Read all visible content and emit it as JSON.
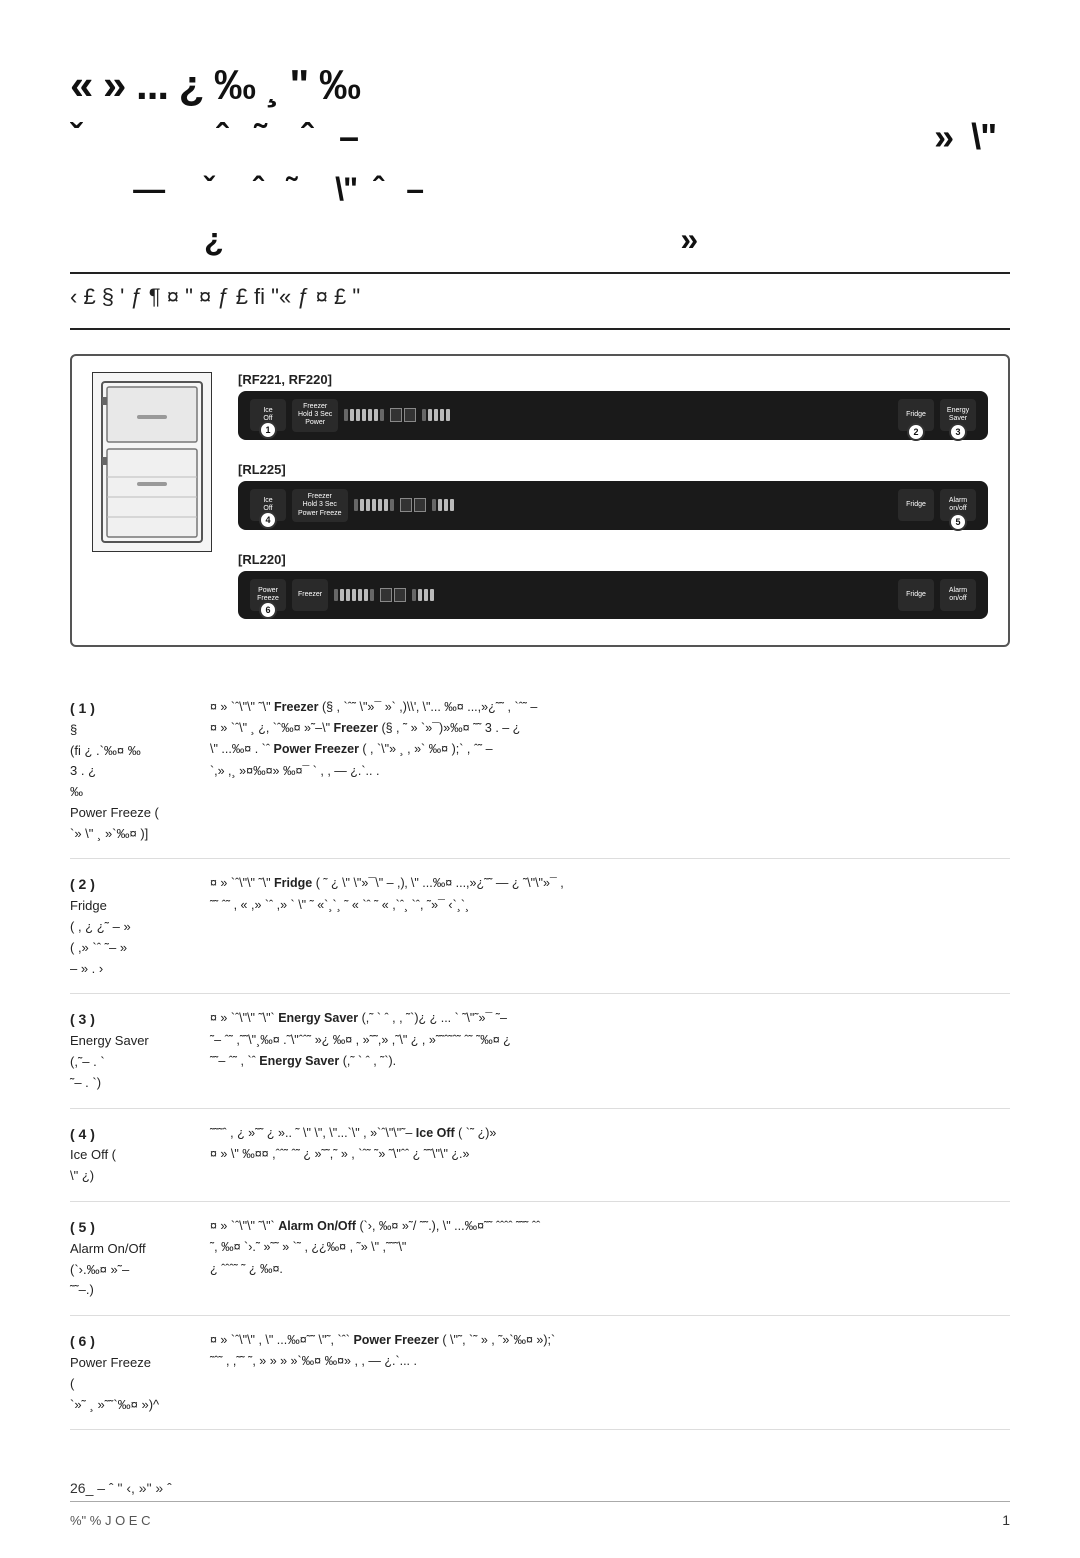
{
  "header": {
    "title_line1": "«  »  ...  ¿  ‰  ¸  \"  ‰",
    "title_line2": "ˇ",
    "title_line3": "›  ˆ  ˜  \"  ˆ  –",
    "title_line4": "¿                    »",
    "subtitle": "‹ £ §  ' ƒ ¶  ¤  \"  ¤  ƒ £ fi \"«   ƒ  ¤ £ \""
  },
  "diagram": {
    "model_rf221": "[RF221, RF220]",
    "model_rl225": "[RL225]",
    "model_rl220": "[RL220]"
  },
  "sections": [
    {
      "number": "( 1 )",
      "label": "§",
      "sublabel": "(fi ¿  . `‰¤ ‰",
      "sublabel2": "3   . ¿",
      "sublabel3": "‰",
      "sublabel4": "Power Freeze (",
      "sublabel5": "`» \"  ¸ »`‰¤ )]",
      "content": "¤ »  `ˆ\"\"  ˜\"  Freezer (§  , `ˆ˜ \"»¯ »` ,)\\'‚  \"... ‰¤  ...,»¿˜˜  ,  `ˆ˜  –",
      "content2": "¤ »  `ˆ\"  ¸  ¿,  `ˆ‰¤ »˜–\"  Freezer (§  ,  ˜  »  `»¯)»‰¤ ˜˜  3  . –  ¿",
      "content3": "\"  ...‰¤  .  `ˆ  Power Freezer (  ,  `\"»  ¸  ,  »` ‰¤ );`  ,  ˆ˜  –",
      "content4": "`,»  ,¸  »¤‰¤»  ‰¤¯  ` ,  ,  —  ¿.`..  ."
    },
    {
      "number": "( 2 )",
      "label": "Fridge",
      "sublabel": "(  ,  ¿  ¿˜  –  »",
      "sublabel2": "(  ,»  `ˆ  ˜–  »",
      "sublabel3": "–  »  . ›",
      "content": "¤ »  `ˆ\"\"  ˜\"  Fridge (  ˜  ¿  \"  \"»¯\"  –  ,)‚  \"  ...‰¤  ...,»¿˜˜  —  ¿  ˜\"\"»¯  ,",
      "content2": "˜˜  ˆ˜  ,  «  ,»  `ˆ  ,»  `  \"  ˜  «`¸`¸  ˜  «  `ˆ  ˜  «  ,`ˆ¸  `ˆ,  ˜»¯  ‹`¸`¸"
    },
    {
      "number": "( 3 )",
      "label": "Energy Saver",
      "sublabel": "(,˜–  .  `",
      "sublabel2": "˜–  .  `)",
      "content": "¤ »  `ˆ\"\"  ˜\"`  Energy Saver (,˜  `  ˆ  ,  ,  ˜`)¿  ¿  ...  `  ˜\"˜»¯  ˜–",
      "content2": "˜–  ˆ˜  ,˜˜\"¸‰¤ .˜\"ˆˆ˜  »¿ ‰¤ ,  »˜˜,»  ,˜\"  ¿  ,  »˜˜ˆ˜ˆ˜  ˆ˜  ˜‰¤ ¿",
      "content3": "˜˜–  ˆ˜  ,  `ˆ Energy Saver (,˜  `  ˆ  ,  ˜`)."
    },
    {
      "number": "( 4 )",
      "label": "Ice Off (",
      "sublabel": "\"  ¿)",
      "content": "˜˜˜ˆ  ,  ¿  »˜˜  ¿  »..  ˜  \"  \",  \"...`\"  ,  »`ˆ\"\"˜–  Ice Off (  `˜  ¿)»",
      "content2": "¤ »  \" ‰¤¤ ,ˆˆ˜  ˆ˜  ¿  »˜˜,˜ »  ,  `ˆ˜  ˜»  ˜\"ˆˆ  ¿  ˜˜\"\"  ¿.»"
    },
    {
      "number": "( 5 )",
      "label": "Alarm On/Off",
      "sublabel": "(`›.‰¤ »˜–",
      "sublabel2": "˜˜–.)",
      "content": "¤ »  `ˆ\"\"  ˜\"`  Alarm On/Off (`›, ‰¤  »˜/  ˜˜.), \"  ...‰¤˜˜  ˆˆˆˆ  ˜˜˜  ˆˆ",
      "content2": "˜, ‰¤ `›.˜  »˜˜  »  `˜  ,  ¿¿‰¤ ,  ˜»  \"  ,˜˜˜\"",
      "content3": "¿  ˆˆˆ˜  ˜  ¿  ‰¤."
    },
    {
      "number": "( 6 )",
      "label": "Power Freeze",
      "sublabel": "(",
      "sublabel2": "`»˜  ¸  »˜˜`‰¤ »)^",
      "content": "¤ »  `ˆ\"\"  ,  \"  ...‰¤˜˜  \"˜, `ˆ`  Power Freezer (  \"˜,  `˜  »  ,  ˜»`‰¤ »);`",
      "content2": "˜ˆ˜  ,  ,˜˜  ˜,  »  »  »  »`‰¤ ‰¤»  ,  ,  — ¿.`...  ."
    }
  ],
  "footer": {
    "page": "26_  –  ˆ  \"  ‹,  »\"  »  ˆ",
    "model": "%\"    % J O E C",
    "page_num": "1"
  }
}
